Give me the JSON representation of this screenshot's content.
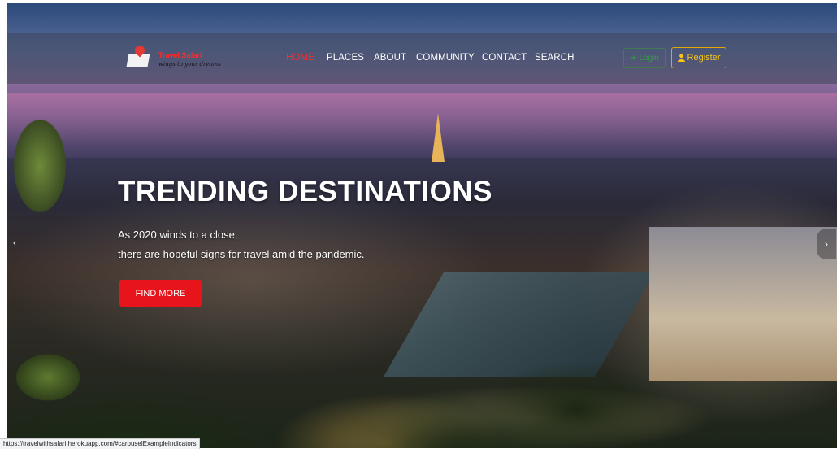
{
  "brand": {
    "name": "Travel Safari",
    "tagline": "wings to your dreams",
    "pin_color": "#e53935"
  },
  "nav": {
    "items": [
      {
        "label": "HOME",
        "active": true
      },
      {
        "label": "PLACES",
        "active": false
      },
      {
        "label": "ABOUT",
        "active": false
      },
      {
        "label": "COMMUNITY",
        "active": false
      },
      {
        "label": "CONTACT",
        "active": false
      },
      {
        "label": "SEARCH",
        "active": false
      }
    ],
    "login_label": "Login",
    "login_icon": "sign-in-icon",
    "register_label": "Register",
    "register_icon": "user-icon",
    "active_color": "#ff2a2a"
  },
  "hero": {
    "title": "TRENDING DESTINATIONS",
    "line1": "As 2020 winds to a close,",
    "line2": "there are hopeful signs for travel amid the pandemic.",
    "button_label": "FIND MORE",
    "button_color": "#e8141c",
    "prev_icon": "‹",
    "next_icon": "›"
  },
  "status_bar": {
    "url": "https://travelwithsafari.herokuapp.com/#carouselExampleIndicators"
  }
}
